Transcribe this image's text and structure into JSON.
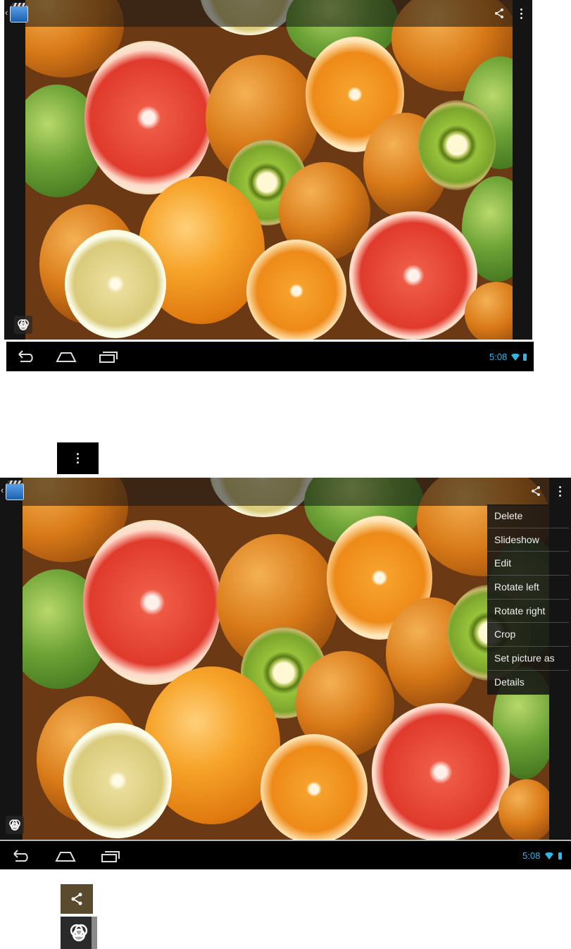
{
  "menu_items": [
    "Delete",
    "Slideshow",
    "Edit",
    "Rotate left",
    "Rotate right",
    "Crop",
    "Set picture as",
    "Details"
  ],
  "status": {
    "time": "5:08"
  },
  "icons": {
    "app": "gallery-app-icon",
    "share": "share-icon",
    "overflow": "overflow-menu-icon",
    "effects": "photo-effects-icon",
    "back": "back-icon",
    "home": "home-icon",
    "recent": "recent-apps-icon",
    "wifi": "wifi-icon",
    "battery": "battery-icon"
  },
  "colors": {
    "status_accent": "#33b5e5",
    "menu_bg": "#141414"
  }
}
